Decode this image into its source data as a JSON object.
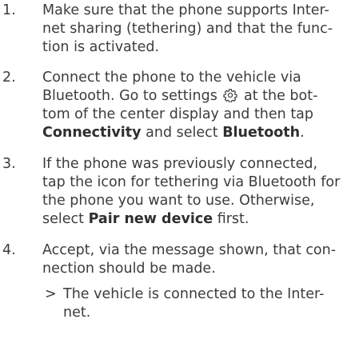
{
  "steps": [
    {
      "number": "1.",
      "lines": [
        "Make sure that the phone supports Inter-",
        "net sharing (tethering) and that the func-",
        "tion is activated."
      ]
    },
    {
      "number": "2.",
      "line1": "Connect the phone to the vehicle via",
      "line2_pre": "Bluetooth. Go to settings",
      "line2_post": "at the bot-",
      "line3_pre": "tom of the center display and then tap",
      "line4_bold1": "Connectivity",
      "line4_mid": "and select",
      "line4_bold2": "Bluetooth",
      "line4_end": ".",
      "icon": "gear-icon"
    },
    {
      "number": "3.",
      "line1": "If the phone was previously connected,",
      "line2": "tap the icon for tethering via Bluetooth for",
      "line3": "the phone you want to use. Otherwise,",
      "line4_pre": "select",
      "line4_bold": "Pair new device",
      "line4_post": "first."
    },
    {
      "number": "4.",
      "lines": [
        "Accept, via the message shown, that con-",
        "nection should be made."
      ],
      "result": {
        "arrow": ">",
        "lines": [
          "The vehicle is connected to the Inter-",
          "net."
        ]
      }
    }
  ]
}
